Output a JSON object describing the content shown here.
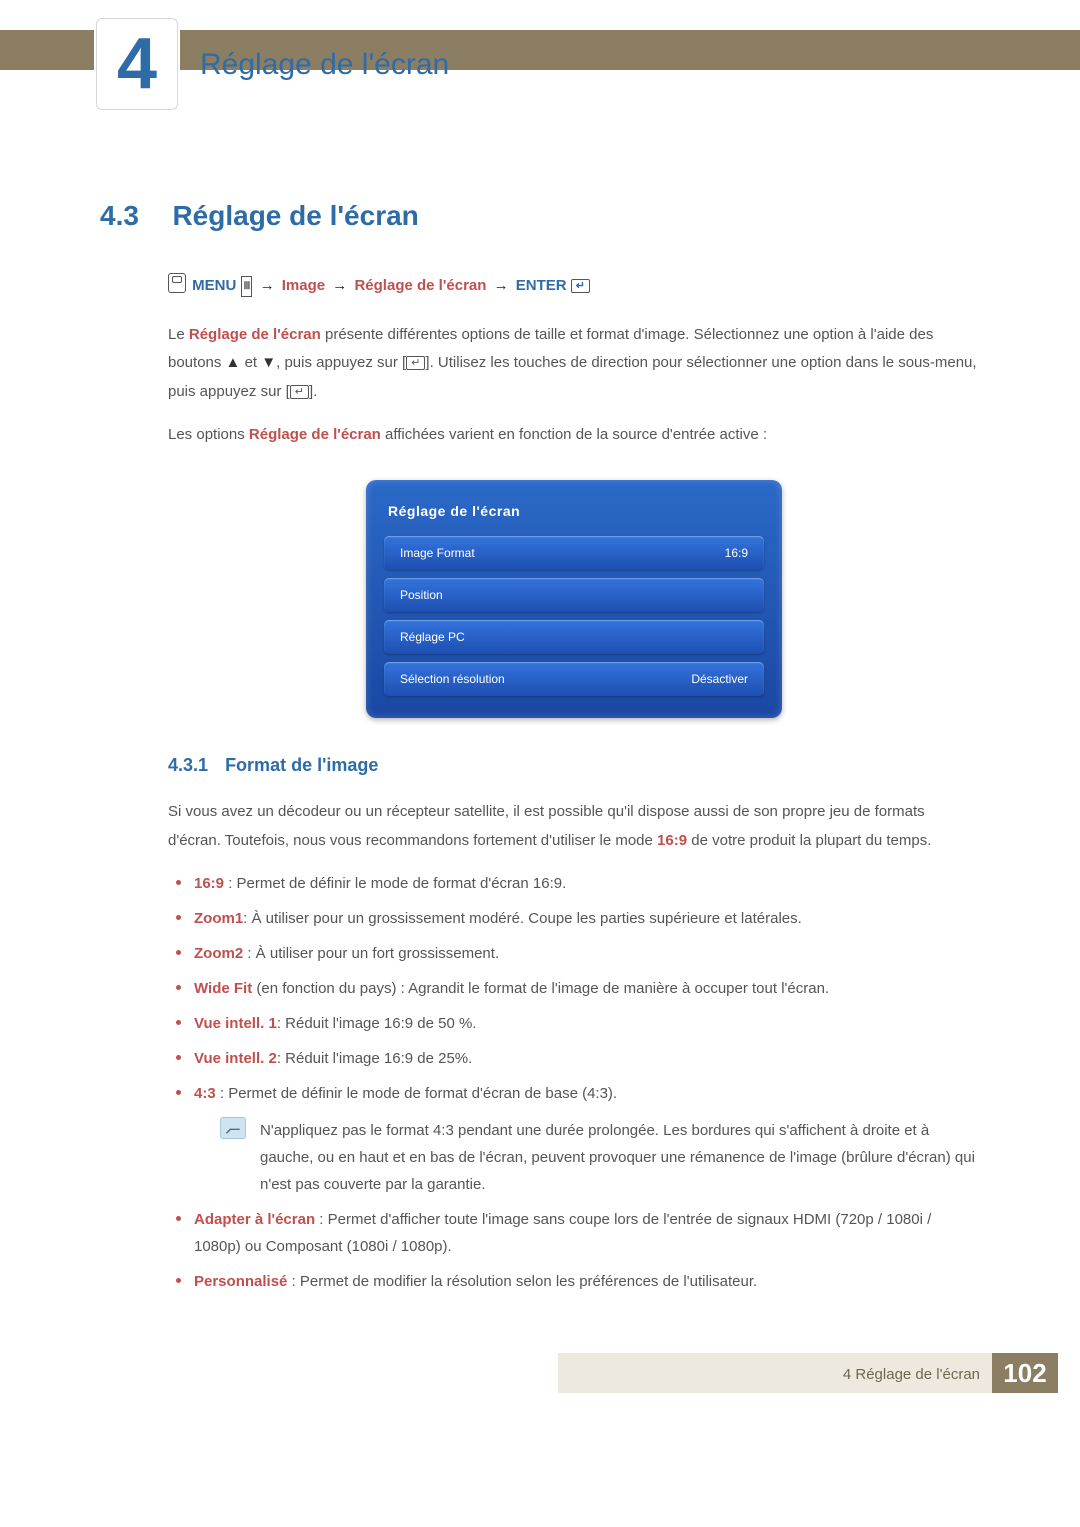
{
  "chapter": {
    "number": "4",
    "title": "Réglage de l'écran"
  },
  "section": {
    "number": "4.3",
    "title": "Réglage de l'écran"
  },
  "navpath": {
    "menu": "MENU",
    "image": "Image",
    "reglage": "Réglage de l'écran",
    "enter": "ENTER"
  },
  "para1_a": "Le ",
  "para1_red": "Réglage de l'écran",
  "para1_b": " présente différentes options de taille et format d'image. Sélectionnez une option à l'aide des boutons ",
  "para1_c": " et ",
  "para1_d": ", puis appuyez sur [",
  "para1_e": "]. Utilisez les touches de direction pour sélectionner une option dans le sous-menu, puis appuyez sur [",
  "para1_f": "].",
  "para2_a": "Les options ",
  "para2_red": "Réglage de l'écran",
  "para2_b": " affichées varient en fonction de la source d'entrée active :",
  "osd": {
    "title": "Réglage de l'écran",
    "rows": [
      {
        "label": "Image Format",
        "value": "16:9"
      },
      {
        "label": "Position",
        "value": ""
      },
      {
        "label": "Réglage PC",
        "value": ""
      },
      {
        "label": "Sélection résolution",
        "value": "Désactiver"
      }
    ]
  },
  "subsection": {
    "number": "4.3.1",
    "title": "Format de l'image"
  },
  "sub_para_a": "Si vous avez un décodeur ou un récepteur satellite, il est possible qu'il dispose aussi de son propre jeu de formats d'écran. Toutefois, nous vous recommandons fortement d'utiliser le mode ",
  "sub_para_red": "16:9",
  "sub_para_b": " de votre produit la plupart du temps.",
  "bullets": {
    "b1_red": "16:9",
    "b1": " : Permet de définir le mode de format d'écran 16:9.",
    "b2_red": "Zoom1",
    "b2": ": À utiliser pour un grossissement modéré. Coupe les parties supérieure et latérales.",
    "b3_red": "Zoom2",
    "b3": " : À utiliser pour un fort grossissement.",
    "b4_red": "Wide Fit",
    "b4": " (en fonction du pays) : Agrandit le format de l'image de manière à occuper tout l'écran.",
    "b5_red": "Vue intell. 1",
    "b5": ": Réduit l'image 16:9 de 50 %.",
    "b6_red": "Vue intell. 2",
    "b6": ": Réduit l'image 16:9 de 25%.",
    "b7_red": "4:3",
    "b7": " : Permet de définir le mode de format d'écran de base (4:3).",
    "note": "N'appliquez pas le format 4:3 pendant une durée prolongée. Les bordures qui s'affichent à droite et à gauche, ou en haut et en bas de l'écran, peuvent provoquer une rémanence de l'image (brûlure d'écran) qui n'est pas couverte par la garantie.",
    "b8_red": "Adapter à l'écran",
    "b8": " : Permet d'afficher toute l'image sans coupe lors de l'entrée de signaux HDMI (720p / 1080i / 1080p) ou Composant (1080i / 1080p).",
    "b9_red": "Personnalisé",
    "b9": " : Permet de modifier la résolution selon les préférences de l'utilisateur."
  },
  "footer": {
    "label": "4  Réglage de l'écran",
    "page": "102"
  }
}
